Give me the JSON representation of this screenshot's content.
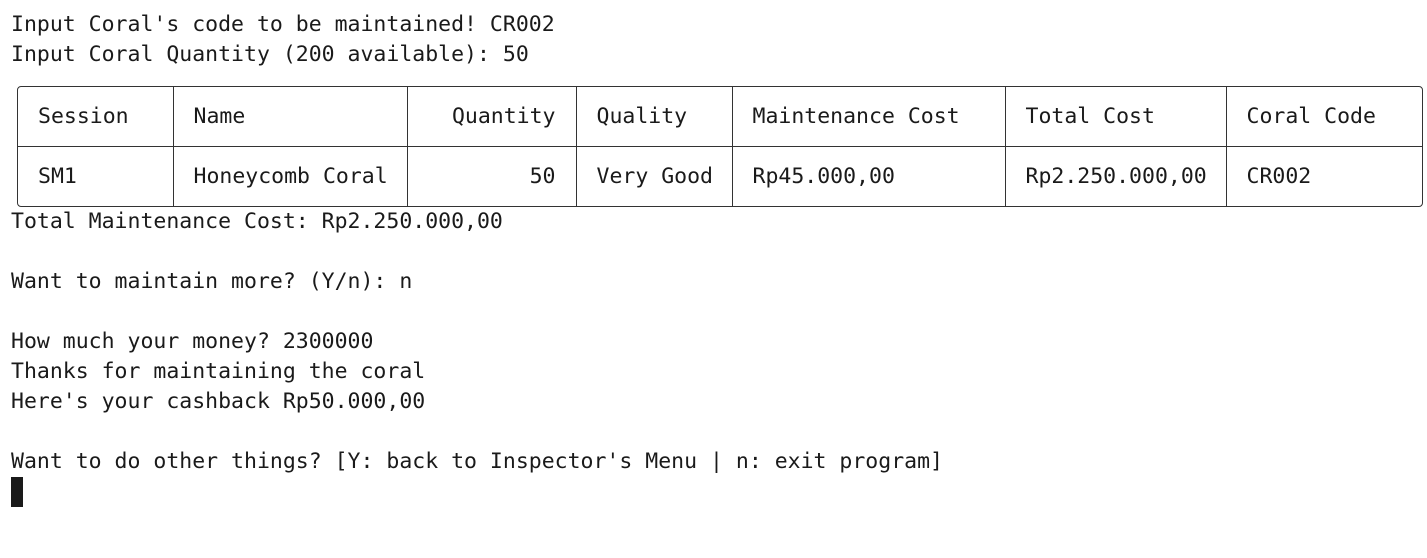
{
  "prompts": {
    "coral_code": "Input Coral's code to be maintained! CR002",
    "coral_quantity": "Input Coral Quantity (200 available): 50"
  },
  "table": {
    "headers": [
      "Session",
      "Name",
      "Quantity",
      "Quality",
      "Maintenance Cost",
      "Total Cost",
      "Coral Code"
    ],
    "rows": [
      [
        "SM1",
        "Honeycomb Coral",
        "50",
        "Very Good",
        "Rp45.000,00",
        "Rp2.250.000,00",
        "CR002"
      ]
    ]
  },
  "summary": {
    "total_cost": "Total Maintenance Cost: Rp2.250.000,00",
    "maintain_more": "Want to maintain more? (Y/n): n",
    "money": "How much your money? 2300000",
    "thanks": "Thanks for maintaining the coral",
    "cashback": "Here's your cashback Rp50.000,00",
    "other_things": "Want to do other things? [Y: back to Inspector's Menu | n: exit program]"
  }
}
